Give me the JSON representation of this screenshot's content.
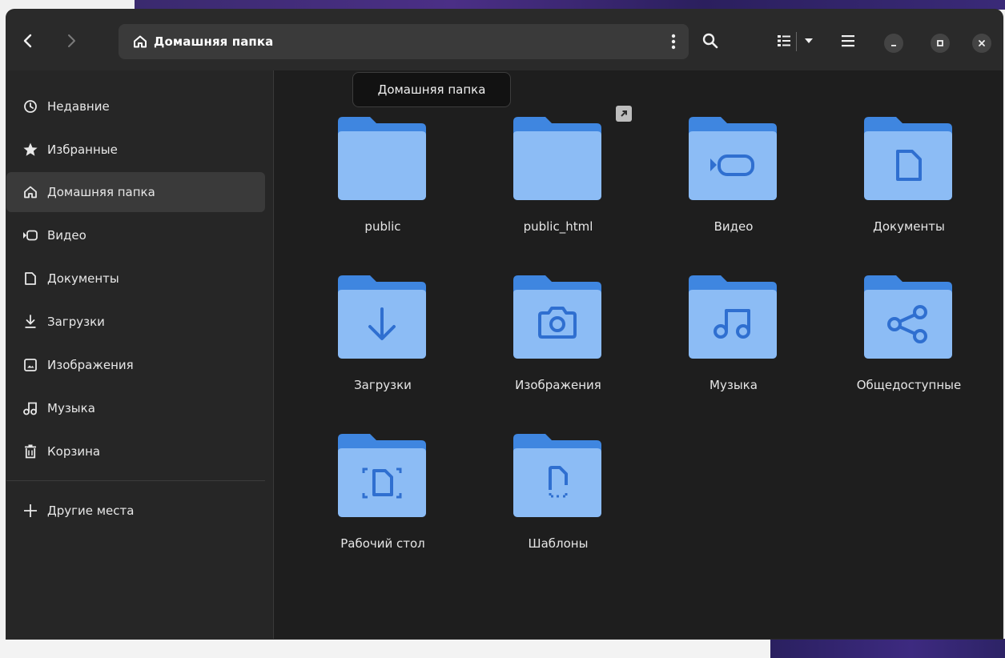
{
  "header": {
    "path": "Домашняя папка",
    "tooltip": "Домашняя папка"
  },
  "sidebar": {
    "items": [
      {
        "label": "Недавние",
        "icon": "clock-icon"
      },
      {
        "label": "Избранные",
        "icon": "star-icon"
      },
      {
        "label": "Домашняя папка",
        "icon": "home-icon"
      },
      {
        "label": "Видео",
        "icon": "video-icon"
      },
      {
        "label": "Документы",
        "icon": "document-icon"
      },
      {
        "label": "Загрузки",
        "icon": "download-icon"
      },
      {
        "label": "Изображения",
        "icon": "image-icon"
      },
      {
        "label": "Музыка",
        "icon": "music-icon"
      },
      {
        "label": "Корзина",
        "icon": "trash-icon"
      }
    ],
    "other_places": "Другие места"
  },
  "files": [
    {
      "label": "public",
      "icon": "folder-icon"
    },
    {
      "label": "public_html",
      "icon": "folder-icon"
    },
    {
      "label": "Видео",
      "icon": "video-folder-icon"
    },
    {
      "label": "Документы",
      "icon": "documents-folder-icon"
    },
    {
      "label": "Загрузки",
      "icon": "downloads-folder-icon"
    },
    {
      "label": "Изображения",
      "icon": "pictures-folder-icon"
    },
    {
      "label": "Музыка",
      "icon": "music-folder-icon"
    },
    {
      "label": "Общедоступные",
      "icon": "public-share-folder-icon"
    },
    {
      "label": "Рабочий стол",
      "icon": "desktop-folder-icon"
    },
    {
      "label": "Шаблоны",
      "icon": "templates-folder-icon"
    }
  ],
  "colors": {
    "folder_back": "#3f86e0",
    "folder_front": "#8cbcf5",
    "folder_glyph": "#2f6fd0"
  }
}
